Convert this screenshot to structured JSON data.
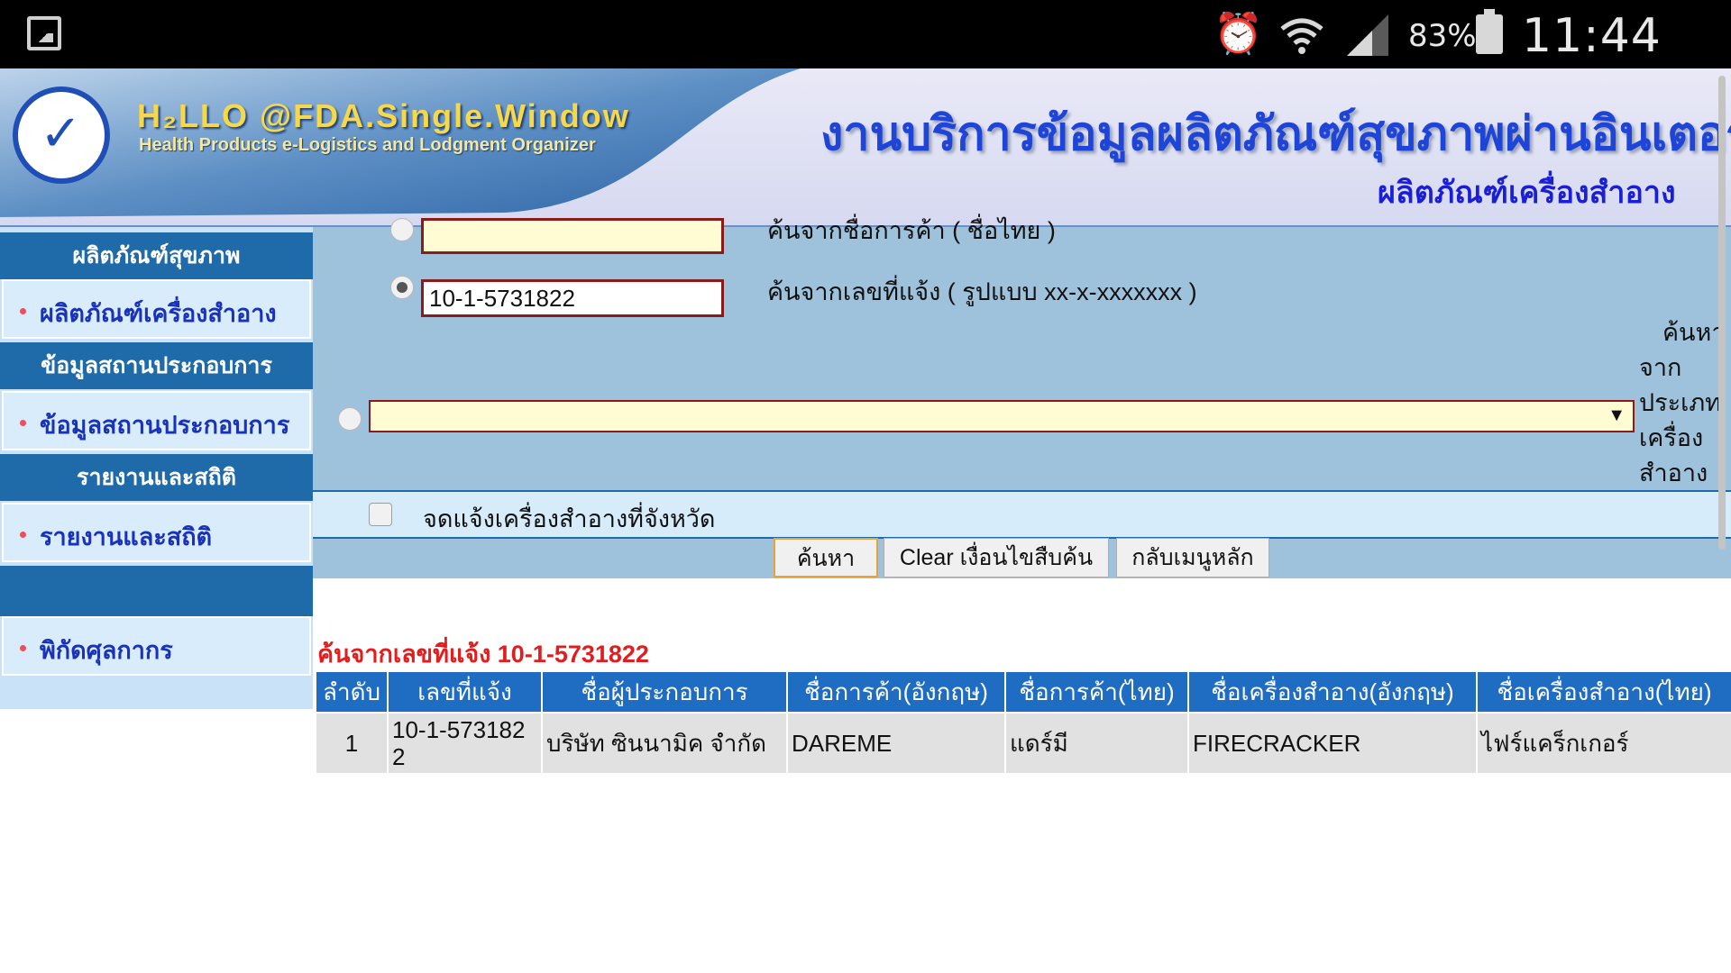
{
  "status_bar": {
    "battery_percent": "83%",
    "time": "11:44 PM",
    "icons": [
      "gallery-icon",
      "alarm-icon",
      "wifi-icon",
      "signal-icon",
      "battery-icon"
    ]
  },
  "header": {
    "brand": "H₂LLO @FDA.Single.Window",
    "brand_sub": "Health Products e-Logistics and Lodgment Organizer",
    "title": "งานบริการข้อมูลผลิตภัณฑ์สุขภาพผ่านอินเตอร์เน็ต",
    "subtitle": "ผลิตภัณฑ์เครื่องสำอาง"
  },
  "sidebar": {
    "sections": [
      {
        "heading": "ผลิตภัณฑ์สุขภาพ",
        "item": "ผลิตภัณฑ์เครื่องสำอาง"
      },
      {
        "heading": "ข้อมูลสถานประกอบการ",
        "item": "ข้อมูลสถานประกอบการ"
      },
      {
        "heading": "รายงานและสถิติ",
        "item": "รายงานและสถิติ"
      },
      {
        "heading": "",
        "item": "พิกัดศุลกากร"
      }
    ]
  },
  "search": {
    "partial_label": "ค้นจากชื่อการค้า ( ชื่อไทย )",
    "notify_value": "10-1-5731822",
    "notify_label": "ค้นจากเลขที่แจ้ง ( รูปแบบ xx-x-xxxxxxx )",
    "type_label_lines": [
      "ค้นหา",
      "จาก",
      "ประเภท",
      "เครื่อง",
      "สำอาง"
    ],
    "province_label": "จดแจ้งเครื่องสำอางที่จังหวัด",
    "buttons": {
      "search": "ค้นหา",
      "clear": "Clear เงื่อนไขสืบค้น",
      "back": "กลับเมนูหลัก"
    }
  },
  "results": {
    "title": "ค้นจากเลขที่แจ้ง 10-1-5731822",
    "columns": [
      "ลำดับ",
      "เลขที่แจ้ง",
      "ชื่อผู้ประกอบการ",
      "ชื่อการค้า(อังกฤษ)",
      "ชื่อการค้า(ไทย)",
      "ชื่อเครื่องสำอาง(อังกฤษ)",
      "ชื่อเครื่องสำอาง(ไทย)"
    ],
    "rows": [
      [
        "1",
        "10-1-5731822",
        "บริษัท ซินนามิค จำกัด",
        "DAREME",
        "แดร์มี",
        "FIRECRACKER",
        "ไฟร์แคร็กเกอร์"
      ]
    ]
  }
}
